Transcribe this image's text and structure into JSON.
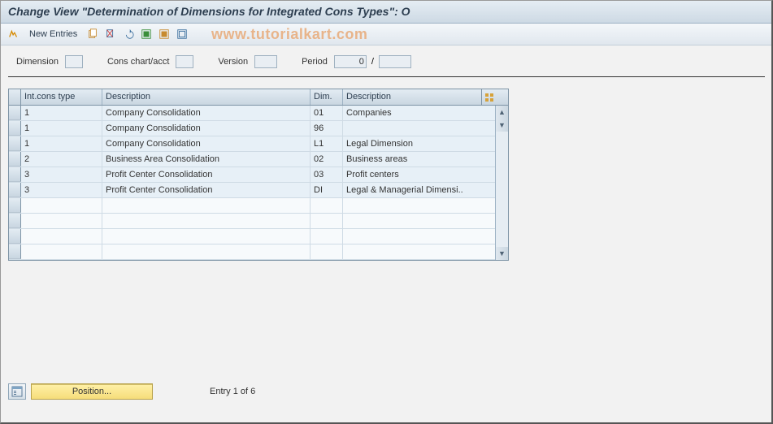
{
  "title": "Change View \"Determination of Dimensions for Integrated Cons Types\": O",
  "watermark": "www.tutorialkart.com",
  "toolbar": {
    "new_entries": "New Entries"
  },
  "filters": {
    "dimension_label": "Dimension",
    "dimension_value": "",
    "cons_label": "Cons chart/acct",
    "cons_value": "",
    "version_label": "Version",
    "version_value": "",
    "period_label": "Period",
    "period_value": "0",
    "period_sep": "/",
    "period_value2": ""
  },
  "grid": {
    "headers": {
      "type": "Int.cons type",
      "desc1": "Description",
      "dim": "Dim.",
      "desc2": "Description"
    },
    "rows": [
      {
        "type": "1",
        "desc1": "Company Consolidation",
        "dim": "01",
        "desc2": "Companies"
      },
      {
        "type": "1",
        "desc1": "Company Consolidation",
        "dim": "96",
        "desc2": ""
      },
      {
        "type": "1",
        "desc1": "Company Consolidation",
        "dim": "L1",
        "desc2": "Legal Dimension"
      },
      {
        "type": "2",
        "desc1": "Business Area Consolidation",
        "dim": "02",
        "desc2": "Business areas"
      },
      {
        "type": "3",
        "desc1": "Profit Center Consolidation",
        "dim": "03",
        "desc2": "Profit centers"
      },
      {
        "type": "3",
        "desc1": "Profit Center Consolidation",
        "dim": "DI",
        "desc2": "Legal & Managerial Dimensi.."
      }
    ]
  },
  "footer": {
    "position": "Position...",
    "entry": "Entry 1 of 6"
  }
}
